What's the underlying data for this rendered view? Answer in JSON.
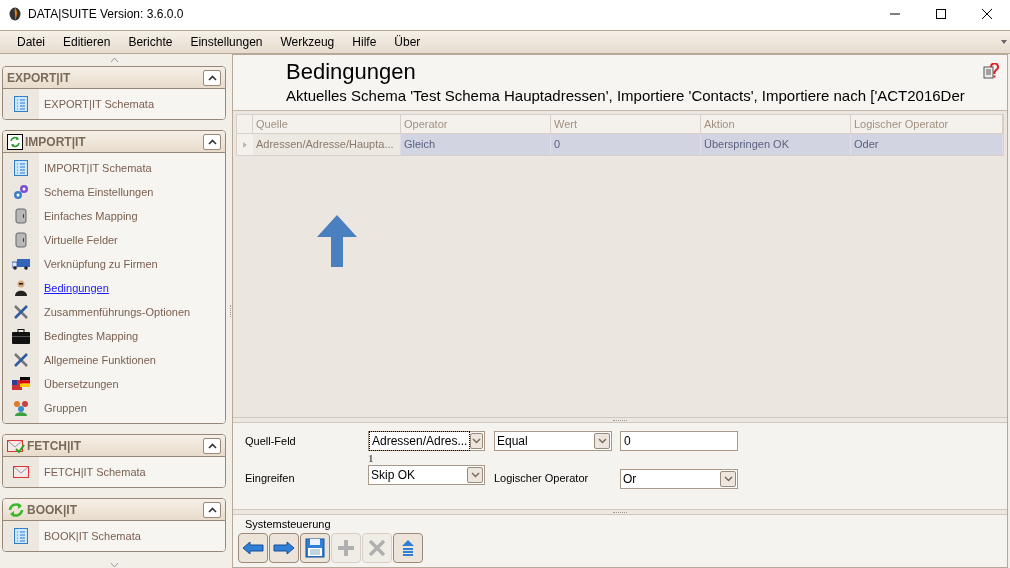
{
  "window": {
    "title": "DATA|SUITE Version: 3.6.0.0"
  },
  "menu": [
    "Datei",
    "Editieren",
    "Berichte",
    "Einstellungen",
    "Werkzeug",
    "Hilfe",
    "Über"
  ],
  "sidebar": {
    "groups": [
      {
        "title": "EXPORT|IT",
        "expanded": true,
        "items": [
          {
            "label": "EXPORT|IT Schemata",
            "selected": false
          }
        ]
      },
      {
        "title": "IMPORT|IT",
        "expanded": true,
        "items": [
          {
            "label": "IMPORT|IT Schemata",
            "selected": false
          },
          {
            "label": "Schema Einstellungen",
            "selected": false
          },
          {
            "label": "Einfaches Mapping",
            "selected": false
          },
          {
            "label": "Virtuelle Felder",
            "selected": false
          },
          {
            "label": "Verknüpfung zu Firmen",
            "selected": false
          },
          {
            "label": "Bedingungen",
            "selected": true
          },
          {
            "label": "Zusammenführungs-Optionen",
            "selected": false
          },
          {
            "label": "Bedingtes Mapping",
            "selected": false
          },
          {
            "label": "Allgemeine Funktionen",
            "selected": false
          },
          {
            "label": "Übersetzungen",
            "selected": false
          },
          {
            "label": "Gruppen",
            "selected": false
          }
        ]
      },
      {
        "title": "FETCH|IT",
        "expanded": true,
        "items": [
          {
            "label": "FETCH|IT Schemata",
            "selected": false
          }
        ]
      },
      {
        "title": "BOOK|IT",
        "expanded": true,
        "items": [
          {
            "label": "BOOK|IT Schemata",
            "selected": false
          }
        ]
      }
    ]
  },
  "page": {
    "title": "Bedingungen",
    "subtitle": "Aktuelles Schema 'Test Schema Hauptadressen', Importiere 'Contacts', Importiere nach ['ACT2016Der"
  },
  "table": {
    "columns": [
      "Quelle",
      "Operator",
      "Wert",
      "Aktion",
      "Logischer Operator"
    ],
    "rows": [
      {
        "selected": true,
        "cells": [
          "Adressen/Adresse/Haupta...",
          "Gleich",
          "0",
          "Überspringen OK",
          "Oder"
        ]
      }
    ]
  },
  "form": {
    "source_label": "Quell-Feld",
    "source_value": "Adressen/Adres...",
    "operator_value": "Equal",
    "value": "0",
    "counter": "1",
    "action_label": "Eingreifen",
    "action_value": "Skip OK",
    "logic_label": "Logischer Operator",
    "logic_value": "Or"
  },
  "toolbar": {
    "title": "Systemsteuerung",
    "buttons": [
      {
        "kind": "back",
        "disabled": false
      },
      {
        "kind": "forward",
        "disabled": false
      },
      {
        "kind": "save",
        "disabled": false
      },
      {
        "kind": "add",
        "disabled": true
      },
      {
        "kind": "delete",
        "disabled": true
      },
      {
        "kind": "upload",
        "disabled": false
      }
    ]
  }
}
